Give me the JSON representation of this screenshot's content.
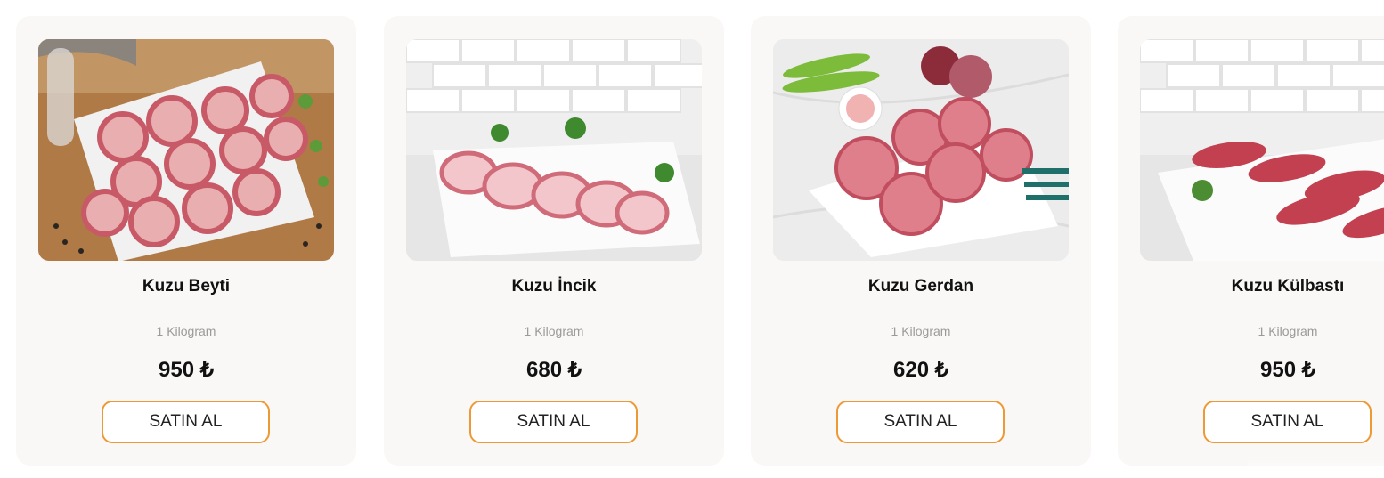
{
  "products": [
    {
      "name": "Kuzu Beyti",
      "unit": "1 Kilogram",
      "price": "950 ₺",
      "button": "SATIN AL",
      "image": "kuzu-beyti-photo"
    },
    {
      "name": "Kuzu İncik",
      "unit": "1 Kilogram",
      "price": "680 ₺",
      "button": "SATIN AL",
      "image": "kuzu-incik-photo"
    },
    {
      "name": "Kuzu Gerdan",
      "unit": "1 Kilogram",
      "price": "620 ₺",
      "button": "SATIN AL",
      "image": "kuzu-gerdan-photo"
    },
    {
      "name": "Kuzu Külbastı",
      "unit": "1 Kilogram",
      "price": "950 ₺",
      "button": "SATIN AL",
      "image": "kuzu-kulbasti-photo"
    }
  ],
  "colors": {
    "card_bg": "#faf8f6",
    "button_border": "#ec9a36",
    "price_text": "#111111",
    "unit_text": "#9a9a9a"
  }
}
